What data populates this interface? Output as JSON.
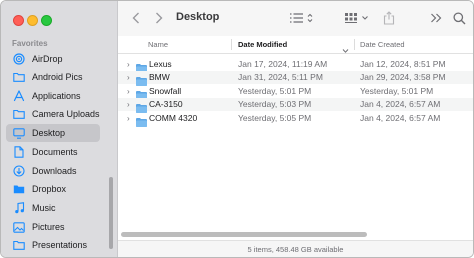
{
  "window": {
    "title": "Desktop"
  },
  "sidebar": {
    "heading": "Favorites",
    "items": [
      {
        "label": "AirDrop",
        "icon": "airdrop-icon"
      },
      {
        "label": "Android Pics",
        "icon": "folder-icon"
      },
      {
        "label": "Applications",
        "icon": "applications-icon"
      },
      {
        "label": "Camera Uploads",
        "icon": "folder-icon"
      },
      {
        "label": "Desktop",
        "icon": "desktop-icon",
        "selected": true
      },
      {
        "label": "Documents",
        "icon": "document-icon"
      },
      {
        "label": "Downloads",
        "icon": "downloads-icon"
      },
      {
        "label": "Dropbox",
        "icon": "dropbox-icon"
      },
      {
        "label": "Music",
        "icon": "music-icon"
      },
      {
        "label": "Pictures",
        "icon": "pictures-icon"
      },
      {
        "label": "Presentations",
        "icon": "folder-icon"
      }
    ]
  },
  "columns": {
    "name": "Name",
    "date_modified": "Date Modified",
    "date_created": "Date Created"
  },
  "files": [
    {
      "name": "Lexus",
      "modified": "Jan 17, 2024, 11:19 AM",
      "created": "Jan 12, 2024, 8:51 PM"
    },
    {
      "name": "BMW",
      "modified": "Jan 31, 2024, 5:11 PM",
      "created": "Jan 29, 2024, 3:58 PM"
    },
    {
      "name": "Snowfall",
      "modified": "Yesterday, 5:01 PM",
      "created": "Yesterday, 5:01 PM"
    },
    {
      "name": "CA-3150",
      "modified": "Yesterday, 5:03 PM",
      "created": "Jan 4, 2024, 6:57 AM"
    },
    {
      "name": "COMM 4320",
      "modified": "Yesterday, 5:05 PM",
      "created": "Jan 4, 2024, 6:57 AM"
    }
  ],
  "status": {
    "text": "5 items, 458.48 GB available"
  },
  "colors": {
    "accent": "#1a8cff",
    "folder": "#5ea7e6",
    "selection": "#c6c6ca"
  }
}
